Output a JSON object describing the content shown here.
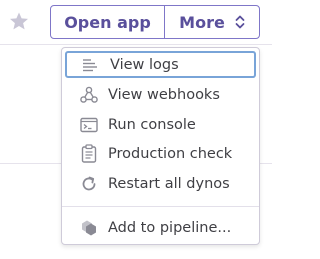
{
  "header": {
    "favorite_icon": "star-icon",
    "open_app_label": "Open app",
    "more_label": "More",
    "more_icon": "chevron-up-down-icon"
  },
  "menu": {
    "items": [
      {
        "label": "View logs",
        "icon": "logs-icon",
        "active": true
      },
      {
        "label": "View webhooks",
        "icon": "webhooks-icon"
      },
      {
        "label": "Run console",
        "icon": "console-icon"
      },
      {
        "label": "Production check",
        "icon": "clipboard-check-icon"
      },
      {
        "label": "Restart all dynos",
        "icon": "restart-icon"
      },
      {
        "label": "Add to pipeline...",
        "icon": "pipeline-icon"
      }
    ]
  },
  "colors": {
    "accent": "#5a509c",
    "button_border": "#7f76c8",
    "active_border": "#79a4d8",
    "text": "#3f3f44",
    "icon": "#8a8a94"
  }
}
